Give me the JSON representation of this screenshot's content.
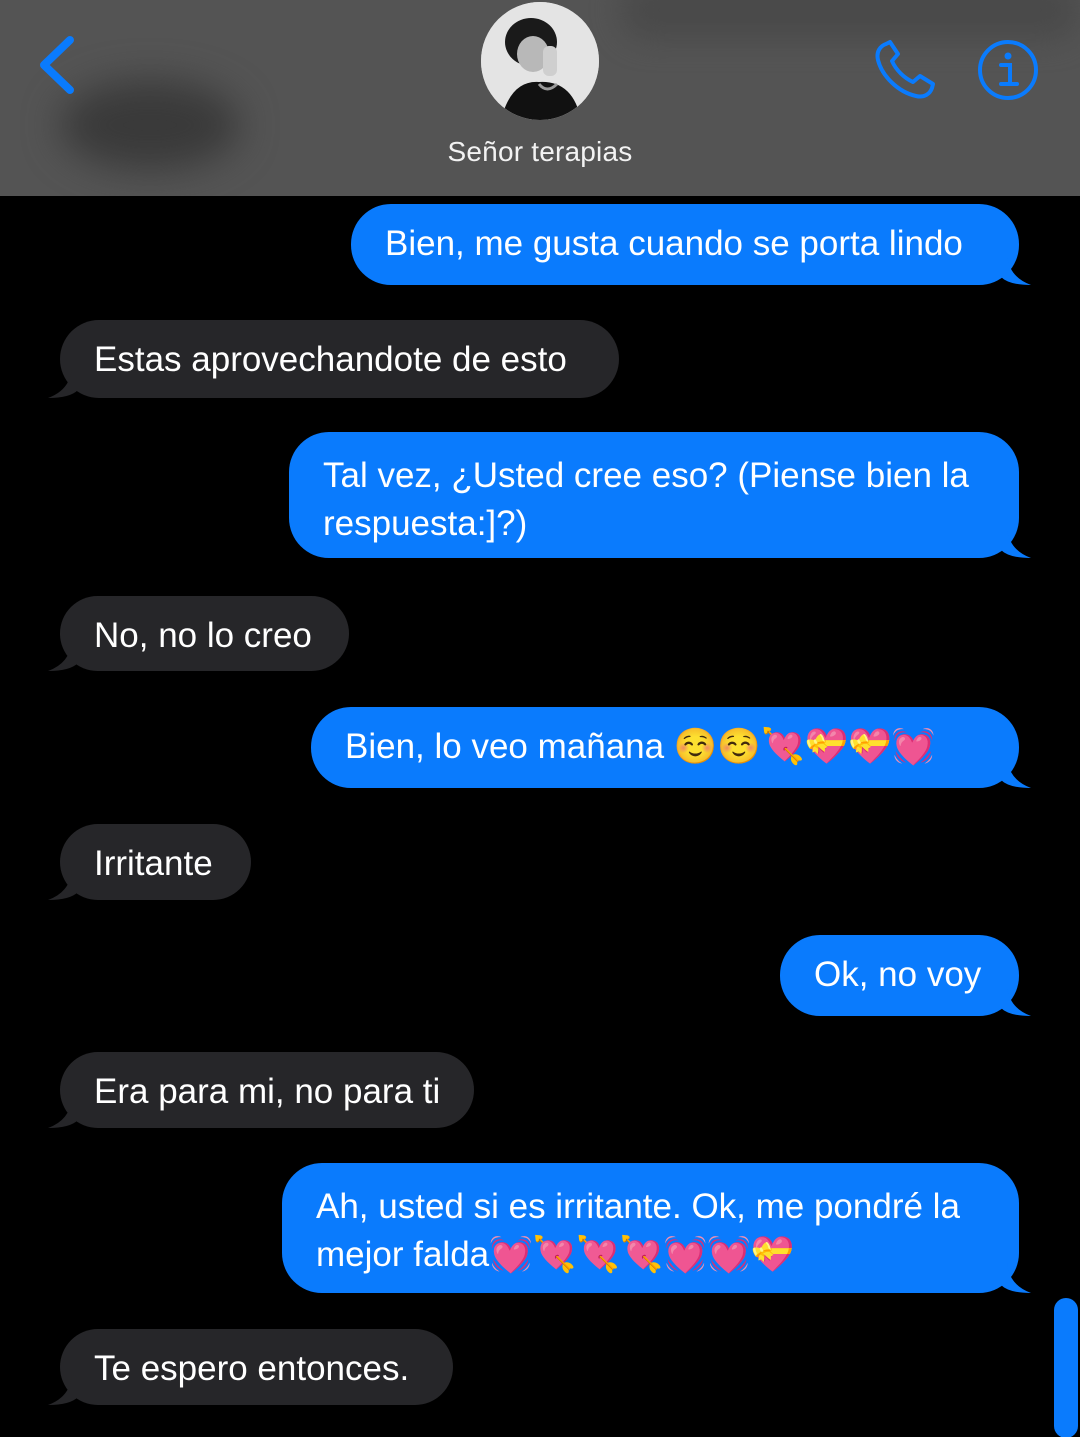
{
  "header": {
    "contact_name": "Señor terapias",
    "back_icon": "chevron-left-icon",
    "call_icon": "phone-icon",
    "info_icon": "info-icon",
    "accent_color": "#0a7bfd",
    "background_color": "#545454"
  },
  "messages": [
    {
      "direction": "sent",
      "text": "Bien, me gusta cuando se porta lindo"
    },
    {
      "direction": "received",
      "text": "Estas aprovechandote de esto"
    },
    {
      "direction": "sent",
      "text": "Tal vez, ¿Usted cree eso? (Piense bien la respuesta:]?)"
    },
    {
      "direction": "received",
      "text": "No, no lo creo"
    },
    {
      "direction": "sent",
      "text": "Bien, lo veo mañana ☺️☺️💘💝💝💓"
    },
    {
      "direction": "received",
      "text": "Irritante"
    },
    {
      "direction": "sent",
      "text": "Ok, no voy"
    },
    {
      "direction": "received",
      "text": "Era para mi, no para ti"
    },
    {
      "direction": "sent",
      "text": "Ah, usted si es irritante. Ok, me pondré la mejor falda💓💘💘💘💓💓💝"
    },
    {
      "direction": "received",
      "text": "Te espero entonces."
    }
  ],
  "colors": {
    "sent_bubble": "#0a7bfd",
    "received_bubble": "#262629",
    "background": "#000000"
  }
}
